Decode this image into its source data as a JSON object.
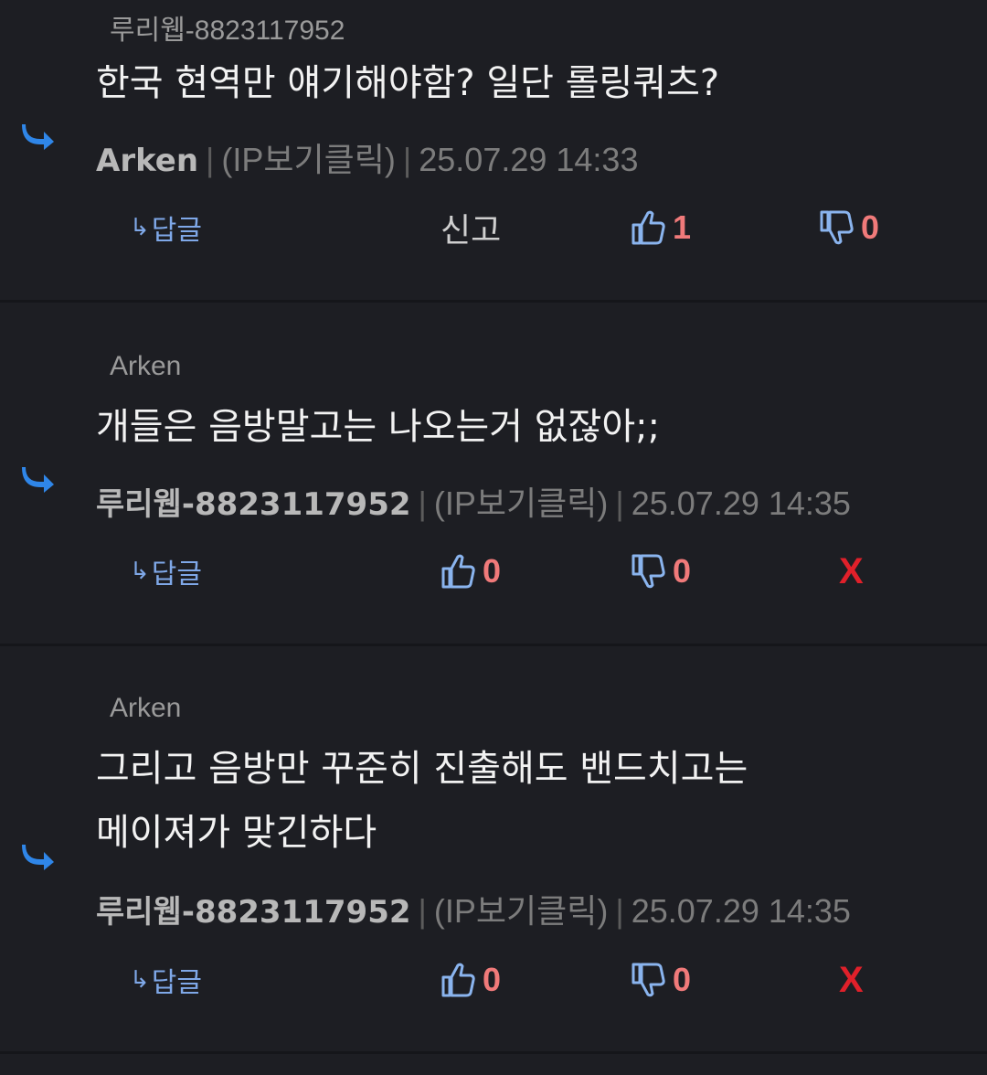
{
  "comments": [
    {
      "reply_to": "루리웹-8823117952",
      "text_lines": [
        "한국 현역만 얘기해야함? 일단 롤링쿼츠?"
      ],
      "author": "Arken",
      "ip_label": "(IP보기클릭)",
      "timestamp": "25.07.29 14:33",
      "reply_label": "답글",
      "report_label": "신고",
      "likes": "1",
      "dislikes": "0"
    },
    {
      "reply_to": "Arken",
      "text_lines": [
        "개들은 음방말고는 나오는거 없잖아;;"
      ],
      "author": "루리웹-8823117952",
      "ip_label": "(IP보기클릭)",
      "timestamp": "25.07.29 14:35",
      "reply_label": "답글",
      "likes": "0",
      "dislikes": "0",
      "delete_label": "X"
    },
    {
      "reply_to": "Arken",
      "text_lines": [
        "그리고 음방만 꾸준히 진출해도 밴드치고는",
        "메이져가 맞긴하다"
      ],
      "author": "루리웹-8823117952",
      "ip_label": "(IP보기클릭)",
      "timestamp": "25.07.29 14:35",
      "reply_label": "답글",
      "likes": "0",
      "dislikes": "0",
      "delete_label": "X"
    }
  ],
  "separator": "|",
  "colors": {
    "background": "#1d1e23",
    "reply_arrow": "#2f86e8",
    "count": "#f07a7a",
    "delete": "#e0202a",
    "reply_button": "#7fa8e8"
  }
}
